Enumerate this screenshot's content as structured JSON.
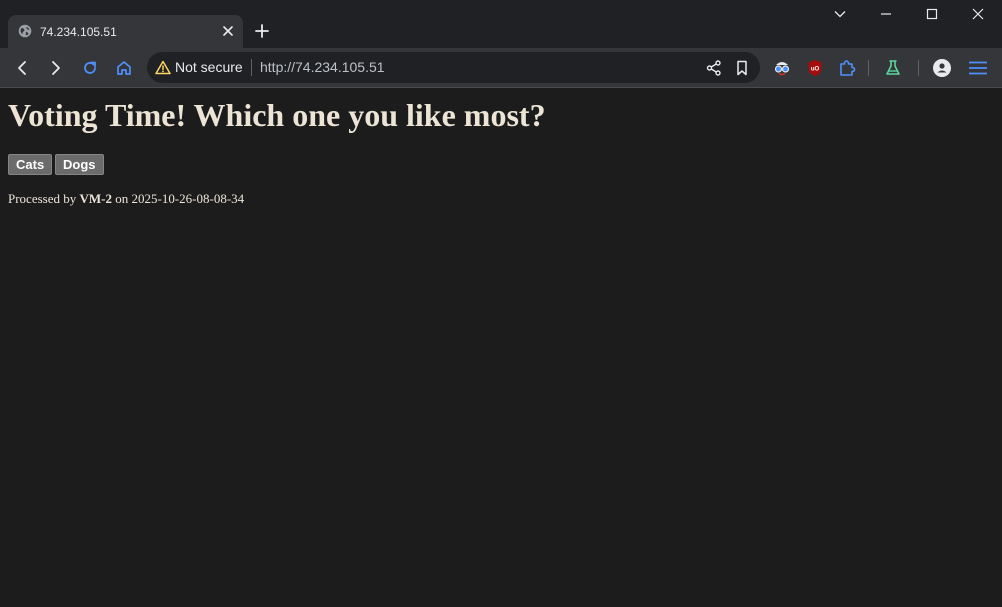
{
  "browser": {
    "tab": {
      "title": "74.234.105.51"
    },
    "omnibox": {
      "security_label": "Not secure",
      "url": "http://74.234.105.51"
    },
    "icons": {
      "tab_favicon": "globe-icon",
      "tab_close": "close-icon",
      "new_tab": "plus-icon",
      "tab_search": "chevron-down-icon",
      "minimize": "minimize-icon",
      "maximize": "maximize-icon",
      "close_window": "close-icon",
      "back": "back-arrow-icon",
      "forward": "forward-arrow-icon",
      "reload": "reload-icon",
      "home": "home-icon",
      "warning": "warning-triangle-icon",
      "share": "share-icon",
      "bookmark": "bookmark-icon",
      "extension_1": "spy-glasses-icon",
      "extension_2": "ublock-shield-icon",
      "extensions": "puzzle-icon",
      "labs": "flask-icon",
      "profile": "person-icon",
      "menu": "hamburger-menu-icon"
    },
    "colors": {
      "tabstrip": "#202124",
      "toolbar": "#35363a",
      "accent": "#4d90fe",
      "warning": "#fdd663",
      "labs": "#5bd6a0"
    }
  },
  "page": {
    "heading": "Voting Time! Which one you like most?",
    "buttons": [
      {
        "label": "Cats"
      },
      {
        "label": "Dogs"
      }
    ],
    "processed": {
      "prefix": "Processed by",
      "host": "VM-2",
      "middle": "on",
      "timestamp": "2025-10-26-08-08-34"
    },
    "colors": {
      "background": "#1c1c1d",
      "text": "#ece5d6",
      "button_bg": "#6b6b6b"
    }
  }
}
